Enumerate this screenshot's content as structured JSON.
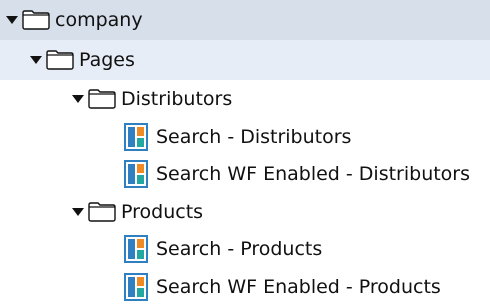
{
  "tree": {
    "root": {
      "label": "company",
      "expanded": true
    },
    "pages": {
      "label": "Pages",
      "expanded": true
    },
    "distributors": {
      "label": "Distributors",
      "expanded": true,
      "children": [
        "Search - Distributors",
        "Search WF Enabled - Distributors"
      ]
    },
    "products": {
      "label": "Products",
      "expanded": true,
      "children": [
        "Search - Products",
        "Search WF Enabled - Products"
      ]
    }
  },
  "colors": {
    "root_row_bg": "#d7dfeb",
    "pages_row_bg": "#e7edf6",
    "doc_icon_blue": "#2f7fc1",
    "doc_icon_orange": "#f08a24",
    "doc_icon_teal": "#22a7a3"
  },
  "icons": {
    "expander": "triangle-down",
    "folder": "folder-outline",
    "page": "report-page"
  }
}
